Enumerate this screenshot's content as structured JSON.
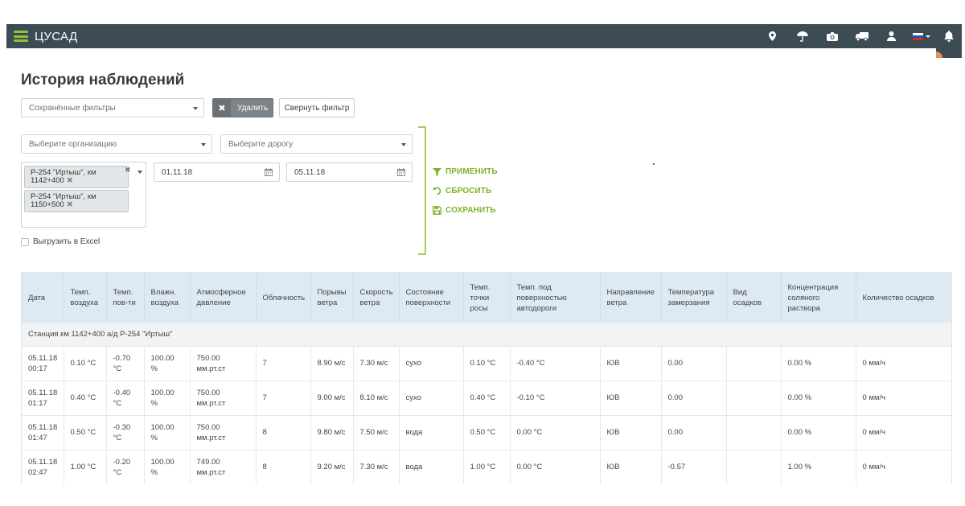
{
  "header": {
    "app_title": "ЦУСАД",
    "icons": [
      "map-marker-icon",
      "umbrella-icon",
      "camera-icon",
      "truck-icon",
      "user-icon",
      "language-flag-icon",
      "bell-icon"
    ]
  },
  "page": {
    "title": "История наблюдений"
  },
  "filters": {
    "saved_filters_placeholder": "Сохранённые фильтры",
    "delete_label": "Удалить",
    "collapse_label": "Свернуть фильтр",
    "organization_placeholder": "Выберите организацию",
    "road_placeholder": "Выберите дорогу",
    "stations": [
      {
        "label": "Р-254 \"Иртыш\", км 1142+400"
      },
      {
        "label": "Р-254 \"Иртыш\", км 1150+500"
      }
    ],
    "date_from": "01.11.18",
    "date_to": "05.11.18",
    "export_label": "Выгрузить в Excel",
    "apply_label": "ПРИМЕНИТЬ",
    "reset_label": "СБРОСИТЬ",
    "save_label": "СОХРАНИТЬ"
  },
  "colors": {
    "header_bg": "#3d4b55",
    "accent_green": "#7db329",
    "table_header_bg": "#dde9f3"
  },
  "table": {
    "columns": [
      "Дата",
      "Темп. воздуха",
      "Темп. пов-ти",
      "Влажн. воздуха",
      "Атмосферное давление",
      "Облачность",
      "Порывы ветра",
      "Скорость ветра",
      "Состояние поверхности",
      "Темп. точки росы",
      "Темп. под поверхностью автодороги",
      "Направление ветра",
      "Температура замерзания",
      "Вид осадков",
      "Концентрация соляного раствора",
      "Количество осадков"
    ],
    "station_label": "Станция км 1142+400 а/д Р-254 \"Иртыш\"",
    "rows": [
      [
        "05.11.18 00:17",
        "0.10 °C",
        "-0.70 °C",
        "100.00 %",
        "750.00 мм.рт.ст",
        "7",
        "8.90 м/с",
        "7.30 м/с",
        "сухо",
        "0.10 °C",
        "-0.40 °C",
        "ЮВ",
        "0.00",
        "",
        "0.00 %",
        "0 мм/ч"
      ],
      [
        "05.11.18 01:17",
        "0.40 °C",
        "-0.40 °C",
        "100.00 %",
        "750.00 мм.рт.ст",
        "7",
        "9.00 м/с",
        "8.10 м/с",
        "сухо",
        "0.40 °C",
        "-0.10 °C",
        "ЮВ",
        "0.00",
        "",
        "0.00 %",
        "0 мм/ч"
      ],
      [
        "05.11.18 01:47",
        "0.50 °C",
        "-0.30 °C",
        "100.00 %",
        "750.00 мм.рт.ст",
        "8",
        "9.80 м/с",
        "7.50 м/с",
        "вода",
        "0.50 °C",
        "0.00 °C",
        "ЮВ",
        "0.00",
        "",
        "0.00 %",
        "0 мм/ч"
      ],
      [
        "05.11.18 02:47",
        "1.00 °C",
        "-0.20 °C",
        "100.00 %",
        "749.00 мм.рт.ст",
        "8",
        "9.20 м/с",
        "7.30 м/с",
        "вода",
        "1.00 °C",
        "0.00 °C",
        "ЮВ",
        "-0.57",
        "",
        "1.00 %",
        "0 мм/ч"
      ]
    ]
  }
}
